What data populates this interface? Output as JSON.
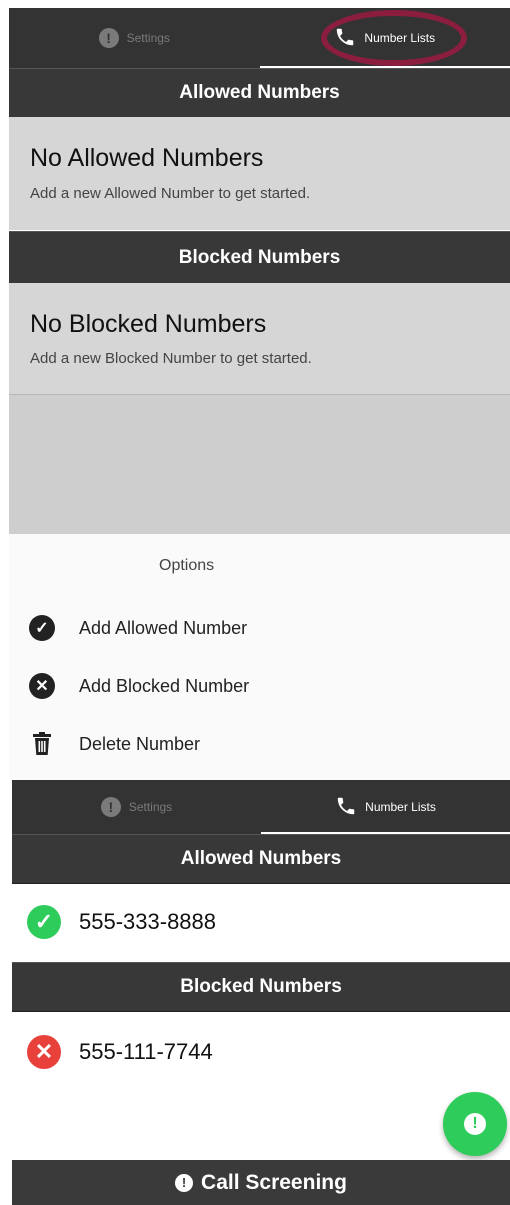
{
  "top": {
    "tabs": [
      {
        "label": "Settings",
        "icon": "alert-icon",
        "active": false
      },
      {
        "label": "Number Lists",
        "icon": "phone-icon",
        "active": true
      }
    ],
    "allowed_header": "Allowed Numbers",
    "allowed_empty_title": "No Allowed Numbers",
    "allowed_empty_sub": "Add a new Allowed Number to get started.",
    "blocked_header": "Blocked Numbers",
    "blocked_empty_title": "No Blocked Numbers",
    "blocked_empty_sub": "Add a new Blocked Number to get started.",
    "highlight_color": "#8b1e3f"
  },
  "sheet": {
    "title": "Options",
    "options": [
      {
        "label": "Add Allowed Number",
        "icon": "check-circle-icon"
      },
      {
        "label": "Add Blocked Number",
        "icon": "x-circle-icon"
      },
      {
        "label": "Delete Number",
        "icon": "trash-icon"
      }
    ]
  },
  "bottom": {
    "tabs": [
      {
        "label": "Settings",
        "icon": "alert-icon",
        "active": false
      },
      {
        "label": "Number Lists",
        "icon": "phone-icon",
        "active": true
      }
    ],
    "allowed_header": "Allowed Numbers",
    "allowed_numbers": [
      {
        "number": "555-333-8888",
        "color": "#2ecc5a"
      }
    ],
    "blocked_header": "Blocked Numbers",
    "blocked_numbers": [
      {
        "number": "555-111-7744",
        "color": "#e8413b"
      }
    ],
    "fab_icon": "alert-icon",
    "footer_label": "Call Screening",
    "footer_icon": "alert-icon"
  }
}
